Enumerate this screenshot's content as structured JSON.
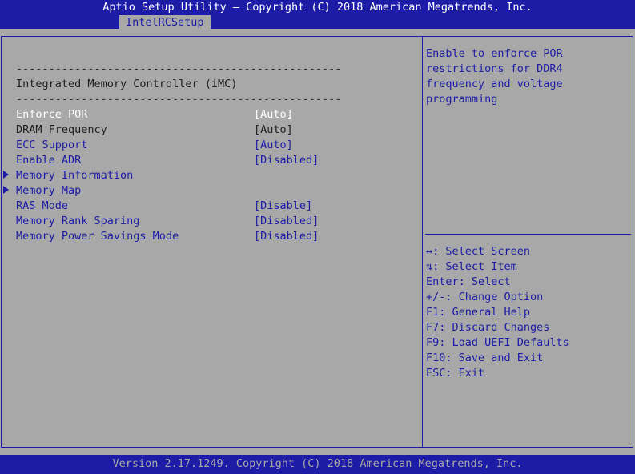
{
  "header": {
    "title": "Aptio Setup Utility – Copyright (C) 2018 American Megatrends, Inc.",
    "tab": "IntelRCSetup"
  },
  "main": {
    "separator": "--------------------------------------------------",
    "heading": "Integrated Memory Controller (iMC)",
    "items": [
      {
        "label": "Enforce POR",
        "value": "[Auto]"
      },
      {
        "label": "DRAM Frequency",
        "value": "[Auto]"
      },
      {
        "label": "ECC Support",
        "value": "[Auto]"
      },
      {
        "label": "Enable ADR",
        "value": "[Disabled]"
      },
      {
        "label": "Memory Information",
        "value": ""
      },
      {
        "label": "Memory Map",
        "value": ""
      },
      {
        "label": "RAS Mode",
        "value": "[Disable]"
      },
      {
        "label": "Memory Rank Sparing",
        "value": "[Disabled]"
      },
      {
        "label": "Memory Power Savings Mode",
        "value": "[Disabled]"
      }
    ]
  },
  "help": {
    "description": [
      "Enable to enforce POR",
      "restrictions for DDR4",
      "frequency and voltage",
      "programming"
    ],
    "keys": [
      "↔: Select Screen",
      "⇅: Select Item",
      "Enter: Select",
      "+/-: Change Option",
      "F1: General Help",
      "F7: Discard Changes",
      "F9: Load UEFI Defaults",
      "F10: Save and Exit",
      "ESC: Exit"
    ]
  },
  "footer": {
    "text": "Version 2.17.1249. Copyright (C) 2018 American Megatrends, Inc."
  },
  "colors": {
    "background": "#a8a8a8",
    "accent": "#1c1ca6",
    "highlight": "#ffffff"
  }
}
